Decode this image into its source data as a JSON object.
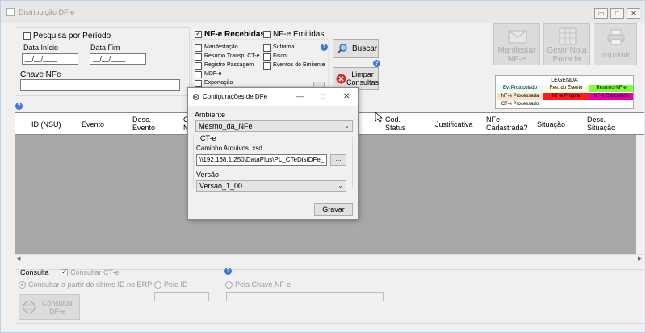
{
  "window": {
    "title": "Distribuição DF-e",
    "min_label": "▭",
    "max_label": "□",
    "close_label": "✕"
  },
  "period": {
    "checkbox_label": "Pesquisa por Período",
    "start_label": "Data Início",
    "end_label": "Data Fim",
    "start_value": "__/__/____",
    "end_value": "__/__/____",
    "chave_label": "Chave NFe",
    "chave_value": ""
  },
  "nfe_type": {
    "recebidas_label": "NF-e Recebidas",
    "emitidas_label": "NF-e Emitidas",
    "recebidas_checked": true,
    "emitidas_checked": false
  },
  "events": {
    "col1": [
      "Manifestação",
      "Resumo Transp. CT-e",
      "Registro Passagem",
      "MDF-e",
      "Exportação"
    ],
    "col2": [
      "Suframa",
      "Fisco",
      "Eventos do Emitente"
    ]
  },
  "actions": {
    "buscar": "Buscar",
    "limpar": "Limpar Consultas",
    "manifestar": "Manifestar NF-e",
    "gerar_nota": "Gerar Nota Entrada",
    "imprimir": "Imprimir"
  },
  "legend": {
    "title": "LEGENDA",
    "items": [
      {
        "label": "Ev. Protocolado",
        "color": "#e8fbfb"
      },
      {
        "label": "Res. do Evento",
        "color": "#fffde0"
      },
      {
        "label": "Resumo NF-e",
        "color": "#7dff3c"
      },
      {
        "label": "NF-e Processada",
        "color": "#ffe2c6"
      },
      {
        "label": "NF-e Própria",
        "color": "#ff1c1c"
      },
      {
        "label": "NF-e Cancelada",
        "color": "#e600a8"
      },
      {
        "label": "CT-e Processado",
        "color": "#ffffff"
      }
    ]
  },
  "grid": {
    "headers": [
      "ID (NSU)",
      "Evento",
      "Desc. Evento",
      "C N",
      "Cod. Status",
      "Justificativa",
      "NFe Cadastrada?",
      "Situação",
      "Desc. Situação"
    ]
  },
  "consulta": {
    "title": "Consulta",
    "consultar_cte": "Consultar CT-e",
    "from_last_id": "Consultar a partir do último ID no ERP",
    "by_id": "Pelo ID",
    "by_chave": "Pela Chave NF-e",
    "button": "Consultar DF-e"
  },
  "dialog": {
    "title": "Configurações de DFe",
    "ambiente_label": "Ambiente",
    "ambiente_value": "Mesmo_da_NFe",
    "cte_group": "CT-e",
    "caminho_label": "Caminho Arquivos .xsd",
    "caminho_value": "\\\\192.168.1.250\\DataPlus\\PL_CTeDistDFe_",
    "browse_label": "...",
    "versao_label": "Versão",
    "versao_value": "Versao_1_00",
    "save_label": "Gravar",
    "min_label": "—",
    "max_label": "□",
    "close_label": "✕"
  }
}
